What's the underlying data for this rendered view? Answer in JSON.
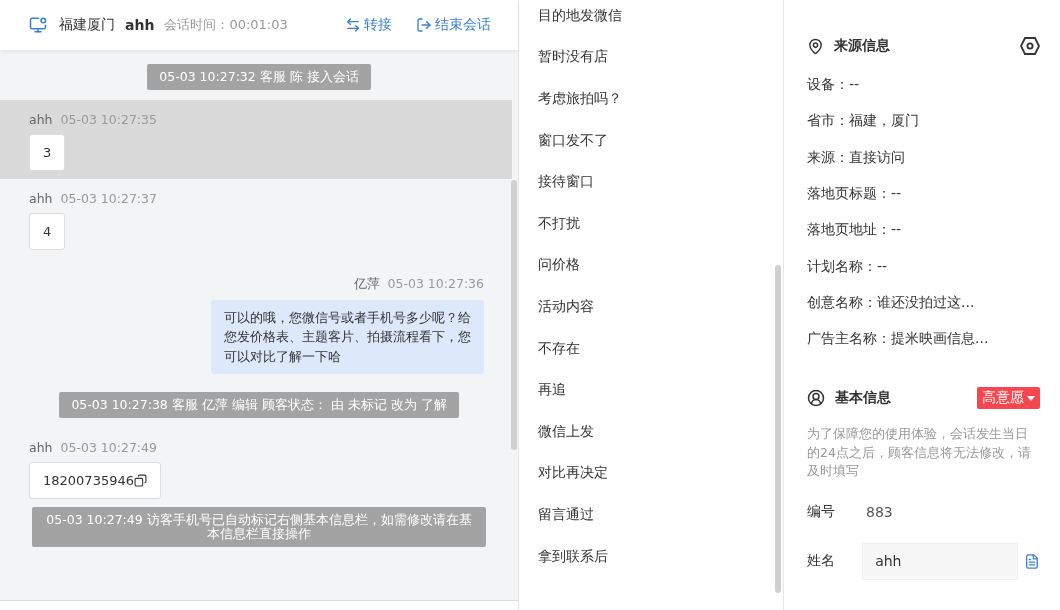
{
  "chat": {
    "header": {
      "location": "福建厦门",
      "visitor": "ahh",
      "duration_label": "会话时间：",
      "duration": "00:01:03",
      "actions": [
        {
          "kind": "transfer",
          "label": "转接"
        },
        {
          "kind": "end",
          "label": "结束会话"
        }
      ]
    },
    "messages": [
      {
        "kind": "system",
        "text": "05-03 10:27:32 客服 陈 接入会话"
      },
      {
        "kind": "visitor",
        "sender": "ahh",
        "time": "05-03 10:27:35",
        "text": "3",
        "highlighted": true,
        "copyable": false
      },
      {
        "kind": "visitor",
        "sender": "ahh",
        "time": "05-03 10:27:37",
        "text": "4",
        "highlighted": false,
        "copyable": false
      },
      {
        "kind": "agent",
        "sender": "亿萍",
        "time": "05-03 10:27:36",
        "text": "可以的哦，您微信号或者手机号多少呢？给您发价格表、主题客片、拍摄流程看下，您可以对比了解一下哈"
      },
      {
        "kind": "system",
        "text": "05-03 10:27:38 客服 亿萍 编辑 顾客状态： 由 未标记 改为 了解"
      },
      {
        "kind": "visitor",
        "sender": "ahh",
        "time": "05-03 10:27:49",
        "text": "18200735946",
        "highlighted": false,
        "copyable": true
      },
      {
        "kind": "system",
        "text": "05-03 10:27:49 访客手机号已自动标记右侧基本信息栏，如需修改请在基本信息栏直接操作"
      }
    ]
  },
  "quick_replies": [
    "目的地发微信",
    "暂时没有店",
    "考虑旅拍吗？",
    "窗口发不了",
    "接待窗口",
    "不打扰",
    "问价格",
    "活动内容",
    "不存在",
    "再追",
    "微信上发",
    "对比再决定",
    "留言通过",
    "拿到联系后"
  ],
  "source_info": {
    "title": "来源信息",
    "rows": [
      "设备：--",
      "省市：福建，厦门",
      "来源：直接访问",
      "落地页标题：--",
      "落地页地址：--",
      "计划名称：--",
      "创意名称：谁还没拍过这...",
      "广告主名称：提米映画信息..."
    ]
  },
  "basic_info": {
    "title": "基本信息",
    "tag": {
      "label": "高意愿",
      "color": "#f5474f"
    },
    "notice": "为了保障您的使用体验，会话发生当日的24点之后，顾客信息将无法修改，请及时填写",
    "fields": [
      {
        "kind": "text",
        "label": "编号",
        "value": "883"
      },
      {
        "kind": "input",
        "label": "姓名",
        "value": "ahh"
      }
    ]
  }
}
